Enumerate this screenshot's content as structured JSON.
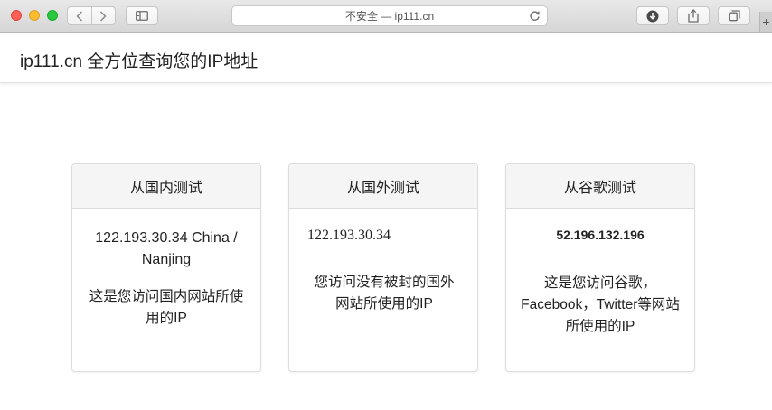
{
  "browser": {
    "address_text": "不安全 — ip111.cn",
    "colors": {
      "close": "#fe5f57",
      "minimize": "#febc2e",
      "zoom": "#28c840"
    },
    "icons": [
      "back-icon",
      "forward-icon",
      "sidebar-icon",
      "reload-icon",
      "download-icon",
      "share-icon",
      "tabs-icon",
      "plus-icon"
    ]
  },
  "header": {
    "title": "ip111.cn 全方位查询您的IP地址"
  },
  "cards": [
    {
      "heading": "从国内测试",
      "ip": "122.193.30.34 China / Nanjing",
      "description": "这是您访问国内网站所使用的IP"
    },
    {
      "heading": "从国外测试",
      "ip": "122.193.30.34",
      "description": "您访问没有被封的国外网站所使用的IP"
    },
    {
      "heading": "从谷歌测试",
      "ip": "52.196.132.196",
      "description": "这是您访问谷歌，Facebook，Twitter等网站所使用的IP"
    }
  ]
}
